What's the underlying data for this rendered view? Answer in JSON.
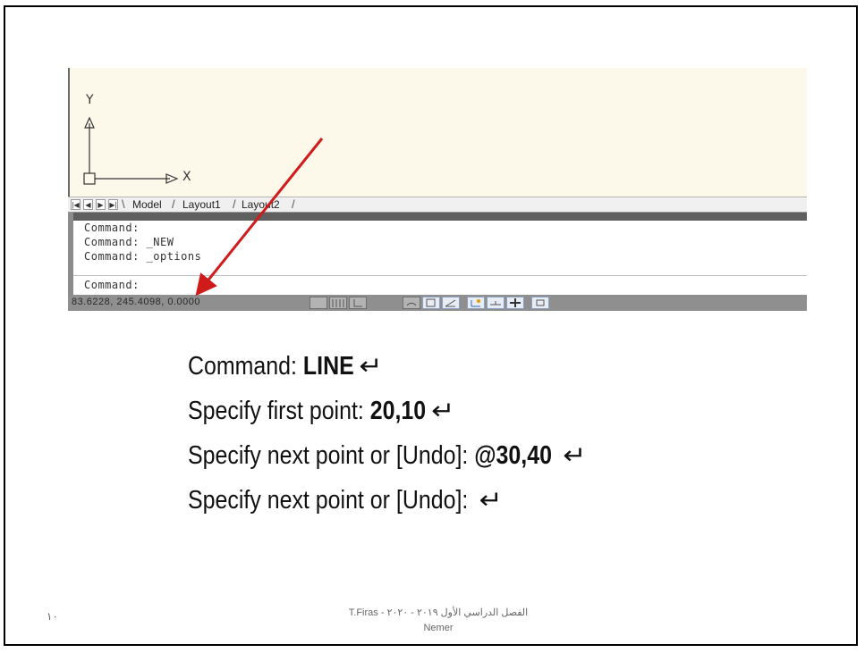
{
  "ucs": {
    "y_label": "Y",
    "x_label": "X"
  },
  "tabs": {
    "nav": [
      "|◀",
      "◀",
      "▶",
      "▶|"
    ],
    "items": [
      "Model",
      "Layout1",
      "Layout2"
    ]
  },
  "command_window": {
    "lines": [
      "Command:",
      "Command:  _NEW",
      "Command:  _options",
      "Command:"
    ]
  },
  "status": {
    "coordinates": "83.6228, 245.4098, 0.0000"
  },
  "instructions": [
    {
      "prefix": "Command: ",
      "value": "LINE"
    },
    {
      "prefix": "Specify first point: ",
      "value": "20,10"
    },
    {
      "prefix": "Specify next point or [Undo]: ",
      "value": "@30,40"
    },
    {
      "prefix": "Specify next point or [Undo]: ",
      "value": ""
    }
  ],
  "enter_symbol": "↵",
  "footer": {
    "line1": "الفصل الدراسي الأول ٢٠١٩ - ٢٠٢٠  -  T.Firas",
    "line2": "Nemer"
  },
  "page_number": "١٠",
  "colors": {
    "arrow": "#d01b1b",
    "drawing_bg": "#fcf9ea",
    "status_bg": "#8f8f8f"
  }
}
